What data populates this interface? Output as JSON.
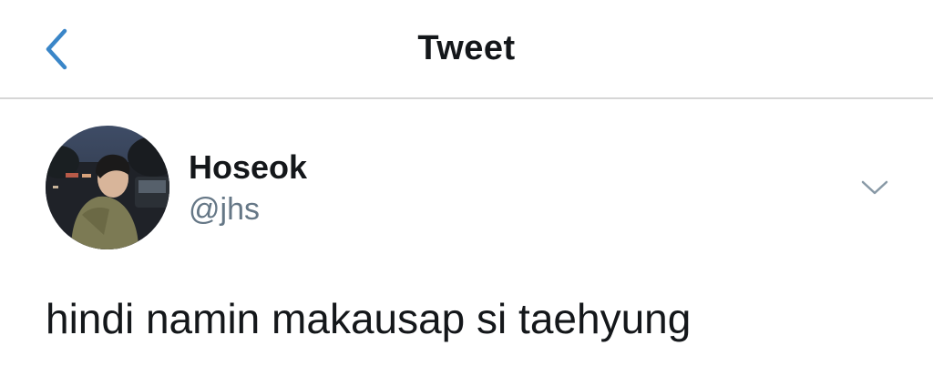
{
  "nav": {
    "back_icon": "chevron-left-icon",
    "title": "Tweet"
  },
  "tweet": {
    "author": {
      "display_name": "Hoseok",
      "handle": "@jhs"
    },
    "menu_icon": "chevron-down-icon",
    "text": "hindi namin makausap si taehyung"
  },
  "colors": {
    "accent": "#3a86c8",
    "text_primary": "#14171a",
    "text_secondary": "#657786",
    "divider": "#d6d6d6",
    "menu_chevron": "#8899a6"
  }
}
